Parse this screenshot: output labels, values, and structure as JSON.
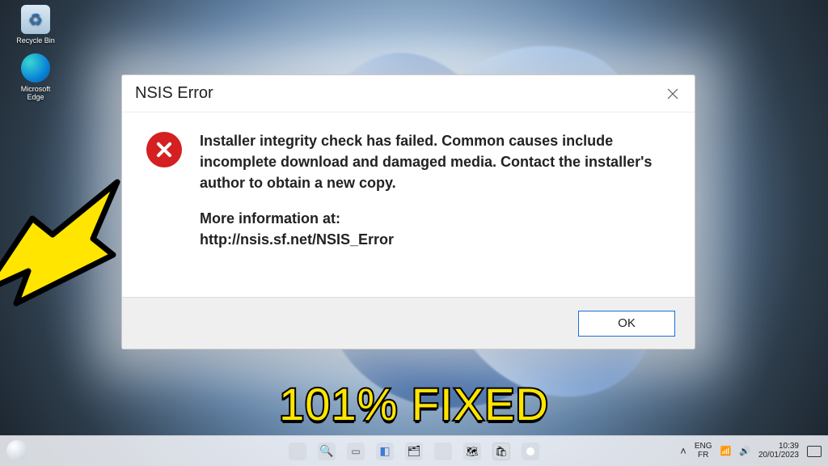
{
  "desktop": {
    "icons": {
      "recycle": "Recycle Bin",
      "edge": "Microsoft Edge"
    }
  },
  "dialog": {
    "title": "NSIS Error",
    "message": "Installer integrity check has failed. Common causes include incomplete download and damaged media. Contact the installer's author to obtain a new copy.",
    "more_info_label": "More information at:",
    "more_info_url": "http://nsis.sf.net/NSIS_Error",
    "ok": "OK"
  },
  "caption": "101% FIXED",
  "taskbar": {
    "lang1": "ENG",
    "lang2": "FR",
    "time": "10:39",
    "date": "20/01/2023"
  }
}
